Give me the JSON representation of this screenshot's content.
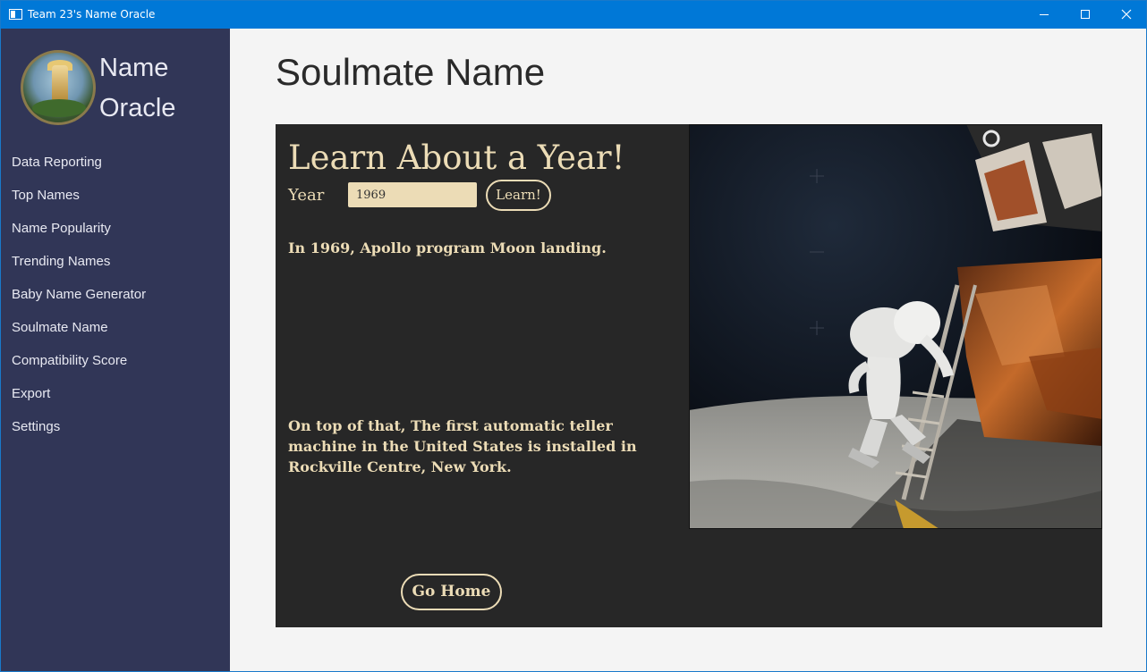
{
  "window": {
    "title": "Team 23's Name Oracle"
  },
  "sidebar": {
    "app_name_line1": "Name",
    "app_name_line2": "Oracle",
    "items": [
      {
        "label": "Data Reporting"
      },
      {
        "label": "Top Names"
      },
      {
        "label": "Name Popularity"
      },
      {
        "label": "Trending Names"
      },
      {
        "label": "Baby Name Generator"
      },
      {
        "label": "Soulmate Name"
      },
      {
        "label": "Compatibility Score"
      },
      {
        "label": "Export"
      },
      {
        "label": "Settings"
      }
    ]
  },
  "main": {
    "page_title": "Soulmate Name",
    "panel": {
      "title": "Learn About a Year!",
      "year_label": "Year",
      "year_value": "1969",
      "learn_button": "Learn!",
      "fact1": "In 1969, Apollo program Moon landing.",
      "fact2": "On top of that, The first automatic teller machine in the United States is installed in Rockville Centre, New York.",
      "home_button": "Go Home"
    }
  },
  "colors": {
    "accent": "#ecdcb6",
    "panel_bg": "#272727",
    "sidebar_bg": "#313657",
    "titlebar": "#0078d7"
  }
}
